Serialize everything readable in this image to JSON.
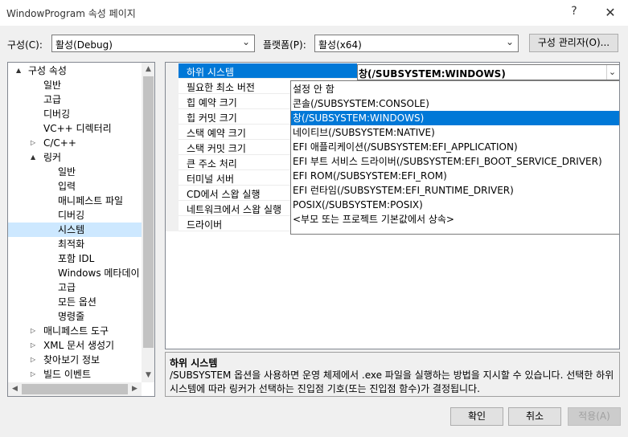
{
  "window": {
    "title": "WindowProgram 속성 페이지",
    "help_glyph": "?",
    "close_glyph": "✕"
  },
  "toolbar": {
    "config_label": "구성(C):",
    "config_value": "활성(Debug)",
    "platform_label": "플랫폼(P):",
    "platform_value": "활성(x64)",
    "config_manager_label": "구성 관리자(O)..."
  },
  "tree": {
    "items": [
      {
        "label": "구성 속성",
        "expander": "▲"
      },
      {
        "label": "일반",
        "expander": ""
      },
      {
        "label": "고급",
        "expander": ""
      },
      {
        "label": "디버깅",
        "expander": ""
      },
      {
        "label": "VC++ 디렉터리",
        "expander": ""
      },
      {
        "label": "C/C++",
        "expander": "▷"
      },
      {
        "label": "링커",
        "expander": "▲"
      },
      {
        "label": "일반",
        "expander": ""
      },
      {
        "label": "입력",
        "expander": ""
      },
      {
        "label": "매니페스트 파일",
        "expander": ""
      },
      {
        "label": "디버깅",
        "expander": ""
      },
      {
        "label": "시스템",
        "expander": ""
      },
      {
        "label": "최적화",
        "expander": ""
      },
      {
        "label": "포함 IDL",
        "expander": ""
      },
      {
        "label": "Windows 메타데이",
        "expander": ""
      },
      {
        "label": "고급",
        "expander": ""
      },
      {
        "label": "모든 옵션",
        "expander": ""
      },
      {
        "label": "명령줄",
        "expander": ""
      },
      {
        "label": "매니페스트 도구",
        "expander": "▷"
      },
      {
        "label": "XML 문서 생성기",
        "expander": "▷"
      },
      {
        "label": "찾아보기 정보",
        "expander": "▷"
      },
      {
        "label": "빌드 이벤트",
        "expander": "▷"
      }
    ],
    "selected_label": "시스템"
  },
  "properties": {
    "rows": [
      "하위 시스템",
      "필요한 최소 버전",
      "힙 예약 크기",
      "힙 커밋 크기",
      "스택 예약 크기",
      "스택 커밋 크기",
      "큰 주소 처리",
      "터미널 서버",
      "CD에서 스왑 실행",
      "네트워크에서 스왑 실행",
      "드라이버"
    ],
    "selected_value": "창(/SUBSYSTEM:WINDOWS)",
    "dropdown_arrow": "⌄"
  },
  "dropdown": {
    "options": [
      "설정 안 함",
      "콘솔(/SUBSYSTEM:CONSOLE)",
      "창(/SUBSYSTEM:WINDOWS)",
      "네이티브(/SUBSYSTEM:NATIVE)",
      "EFI 애플리케이션(/SUBSYSTEM:EFI_APPLICATION)",
      "EFI 부트 서비스 드라이버(/SUBSYSTEM:EFI_BOOT_SERVICE_DRIVER)",
      "EFI ROM(/SUBSYSTEM:EFI_ROM)",
      "EFI 런타임(/SUBSYSTEM:EFI_RUNTIME_DRIVER)",
      "POSIX(/SUBSYSTEM:POSIX)",
      "<부모 또는 프로젝트 기본값에서 상속>"
    ],
    "selected_option": "창(/SUBSYSTEM:WINDOWS)"
  },
  "description": {
    "title": "하위 시스템",
    "text": "/SUBSYSTEM 옵션을 사용하면 운영 체제에서 .exe 파일을 실행하는 방법을 지시할 수 있습니다. 선택한 하위 시스템에 따라 링커가 선택하는 진입점 기호(또는 진입점 함수)가 결정됩니다."
  },
  "buttons": {
    "ok": "확인",
    "cancel": "취소",
    "apply": "적용(A)"
  },
  "colors": {
    "selection_blue": "#0078d7",
    "tree_selection": "#cde8ff",
    "window_bg": "#f0f0f0"
  }
}
